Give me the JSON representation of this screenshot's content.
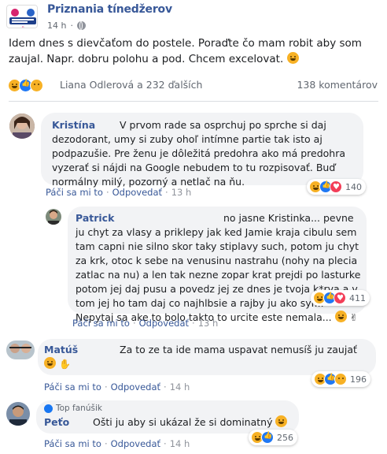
{
  "post": {
    "page_name": "Priznania tínedžerov",
    "time": "14 h",
    "text": "Idem dnes s dievčaťom do postele. Poraďte čo mam robit aby som zaujal. Napr. dobru polohu a pod. Chcem excelovat.",
    "reactors": "Liana Odlerová a 232 ďalších",
    "comments_count": "138 komentárov"
  },
  "comments": [
    {
      "name": "Kristína",
      "text": "V prvom rade sa osprchuj po sprche si daj dezodorant, umy si zuby ohoľ intímne partie tak isto aj podpazušie. Pre ženu je dôležitá predohra ako má predohra vyzerať si nájdi na Google nebudem to tu rozpisovať. Buď normálny milý, pozorný a netlač na ňu.",
      "like": "Páči sa mi to",
      "reply": "Odpovedať",
      "time": "13 h",
      "reaction_count": "140"
    },
    {
      "name": "Patrick",
      "text": "no jasne Kristinka... pevne ju chyt za vlasy a priklepy jak ked Jamie kraja cibulu sem tam capni nie silno skor taky stiplavy such, potom ju chyt za krk, otoc k sebe na venusinu nastrahu (nohy na plecia zatlac na nu) a len tak nezne zopar krat prejdi po lasturke potom jej daj pusu a povedz jej ze dnes je tvoja k*rva a v tom jej ho tam daj co najhlbsie a rajby ju ako syr... Nepytaj sa ake to bolo takto to urcite este nemala...",
      "like": "Páči sa mi to",
      "reply": "Odpovedať",
      "time": "13 h",
      "reaction_count": "411"
    },
    {
      "name": "Matúš",
      "text": "Za to ze ta ide mama uspavat nemusíš ju zaujať",
      "like": "Páči sa mi to",
      "reply": "Odpovedať",
      "time": "14 h",
      "reaction_count": "196"
    },
    {
      "badge": "Top fanúšik",
      "name": "Peťo",
      "text": "Ošti ju aby si ukázal že si dominatný",
      "like": "Páči sa mi to",
      "reply": "Odpovedať",
      "time": "14 h",
      "reaction_count": "256"
    }
  ],
  "colors": {
    "link": "#385898",
    "bubble": "#f2f3f5",
    "meta": "#616770"
  }
}
